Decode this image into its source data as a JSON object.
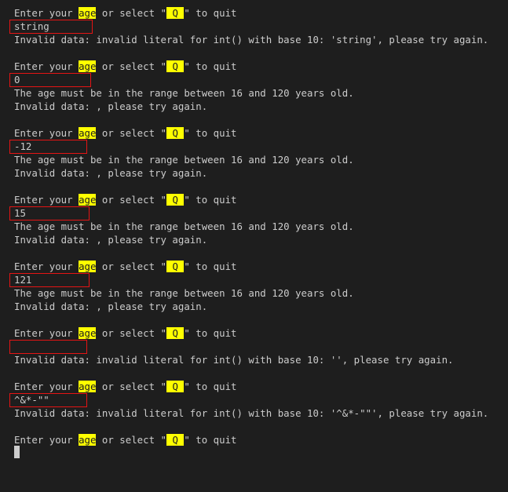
{
  "prompt": {
    "before": "Enter your ",
    "word_age": "age",
    "mid": " or select \"",
    "key_q": " Q ",
    "after": "\" to quit"
  },
  "blocks": [
    {
      "input": "string",
      "messages": [
        "Invalid data: invalid literal for int() with base 10: 'string', please try again."
      ]
    },
    {
      "input": "0",
      "messages": [
        "The age must be in the range between 16 and 120 years old.",
        "Invalid data: , please try again."
      ]
    },
    {
      "input": "-12",
      "messages": [
        "The age must be in the range between 16 and 120 years old.",
        "Invalid data: , please try again."
      ]
    },
    {
      "input": "15",
      "messages": [
        "The age must be in the range between 16 and 120 years old.",
        "Invalid data: , please try again."
      ]
    },
    {
      "input": "121",
      "messages": [
        "The age must be in the range between 16 and 120 years old.",
        "Invalid data: , please try again."
      ]
    },
    {
      "input": "",
      "messages": [
        "Invalid data: invalid literal for int() with base 10: '', please try again."
      ]
    },
    {
      "input": "^&*-\"\"",
      "messages": [
        "Invalid data: invalid literal for int() with base 10: '^&*-\"\"', please try again."
      ]
    }
  ],
  "colors": {
    "background": "#1e1e1e",
    "text": "#cccccc",
    "highlight": "#ffff00",
    "annotation_box": "#e51414"
  }
}
